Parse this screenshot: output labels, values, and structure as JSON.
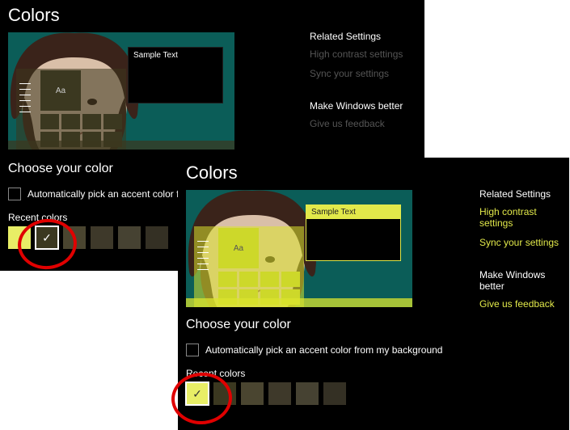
{
  "panelA": {
    "title": "Colors",
    "sample_text": "Sample Text",
    "aa": "Aa",
    "sidebar": {
      "head1": "Related Settings",
      "link1": "High contrast settings",
      "link2": "Sync your settings",
      "head2": "Make Windows better",
      "link3": "Give us feedback"
    },
    "choose": {
      "heading": "Choose your color",
      "auto_label": "Automatically pick an accent color from m",
      "recent_label": "Recent colors"
    }
  },
  "panelB": {
    "title": "Colors",
    "sample_text": "Sample Text",
    "aa": "Aa",
    "sidebar": {
      "head1": "Related Settings",
      "link1": "High contrast settings",
      "link2": "Sync your settings",
      "head2": "Make Windows better",
      "link3": "Give us feedback"
    },
    "choose": {
      "heading": "Choose your color",
      "auto_label": "Automatically pick an accent color from my background",
      "recent_label": "Recent colors"
    }
  }
}
